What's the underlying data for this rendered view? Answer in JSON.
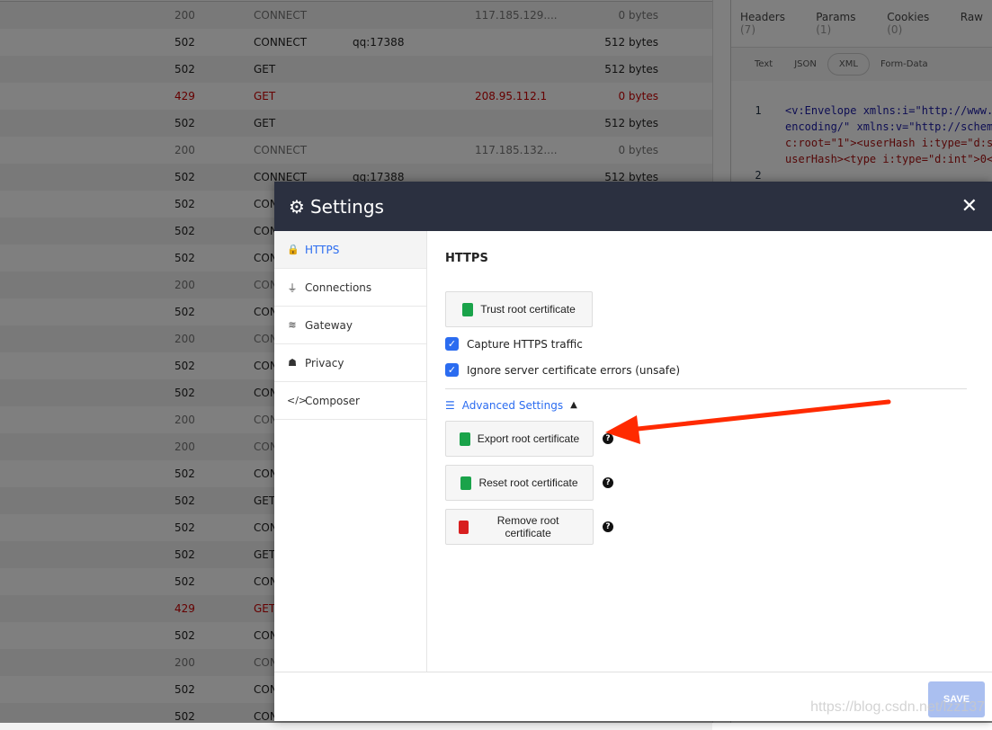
{
  "requests": [
    {
      "status": "200",
      "method": "CONNECT",
      "host": "",
      "ip": "117.185.129....",
      "size": "0 bytes",
      "tone": "gray"
    },
    {
      "status": "502",
      "method": "CONNECT",
      "host": "qq:17388",
      "ip": "",
      "size": "512 bytes",
      "tone": ""
    },
    {
      "status": "502",
      "method": "GET",
      "host": "",
      "ip": "",
      "size": "512 bytes",
      "tone": ""
    },
    {
      "status": "429",
      "method": "GET",
      "host": "",
      "ip": "208.95.112.1",
      "size": "0 bytes",
      "tone": "red"
    },
    {
      "status": "502",
      "method": "GET",
      "host": "",
      "ip": "",
      "size": "512 bytes",
      "tone": ""
    },
    {
      "status": "200",
      "method": "CONNECT",
      "host": "",
      "ip": "117.185.132....",
      "size": "0 bytes",
      "tone": "gray"
    },
    {
      "status": "502",
      "method": "CONNECT",
      "host": "qq:17388",
      "ip": "",
      "size": "512 bytes",
      "tone": ""
    },
    {
      "status": "502",
      "method": "CON",
      "tone": ""
    },
    {
      "status": "502",
      "method": "CON",
      "tone": ""
    },
    {
      "status": "502",
      "method": "CON",
      "tone": ""
    },
    {
      "status": "200",
      "method": "CON",
      "tone": "gray"
    },
    {
      "status": "502",
      "method": "CON",
      "tone": ""
    },
    {
      "status": "200",
      "method": "CON",
      "tone": "gray"
    },
    {
      "status": "502",
      "method": "CON",
      "tone": ""
    },
    {
      "status": "502",
      "method": "CON",
      "tone": ""
    },
    {
      "status": "200",
      "method": "CON",
      "tone": "gray"
    },
    {
      "status": "200",
      "method": "CON",
      "tone": "gray"
    },
    {
      "status": "502",
      "method": "CON",
      "tone": ""
    },
    {
      "status": "502",
      "method": "GET",
      "tone": ""
    },
    {
      "status": "502",
      "method": "CON",
      "tone": ""
    },
    {
      "status": "502",
      "method": "GET",
      "tone": ""
    },
    {
      "status": "502",
      "method": "CON",
      "tone": ""
    },
    {
      "status": "429",
      "method": "GET",
      "tone": "red"
    },
    {
      "status": "502",
      "method": "CON",
      "tone": ""
    },
    {
      "status": "200",
      "method": "CON",
      "tone": "gray"
    },
    {
      "status": "502",
      "method": "CON",
      "tone": ""
    },
    {
      "status": "502",
      "method": "CON",
      "tone": ""
    }
  ],
  "detail": {
    "tabs": [
      {
        "label": "Headers",
        "count": "(7)"
      },
      {
        "label": "Params",
        "count": "(1)"
      },
      {
        "label": "Cookies",
        "count": "(0)"
      },
      {
        "label": "Raw",
        "count": ""
      }
    ],
    "body_tabs": [
      "Text",
      "JSON",
      "XML",
      "Form-Data"
    ],
    "active_body_tab": "XML",
    "code_lines": [
      "<v:Envelope xmlns:i=\"http://www.",
      "encoding/\" xmlns:v=\"http://schem",
      "c:root=\"1\"><userHash i:type=\"d:s",
      "userHash><type i:type=\"d:int\">0<"
    ],
    "line_numbers": [
      "1",
      "2"
    ]
  },
  "settings": {
    "title": "Settings",
    "close": "✕",
    "nav": [
      {
        "label": "HTTPS",
        "icon": "lock-icon",
        "glyph": "🔒"
      },
      {
        "label": "Connections",
        "icon": "plug-icon",
        "glyph": "⏚"
      },
      {
        "label": "Gateway",
        "icon": "wifi-icon",
        "glyph": "≋"
      },
      {
        "label": "Privacy",
        "icon": "user-lock-icon",
        "glyph": "☗"
      },
      {
        "label": "Composer",
        "icon": "code-icon",
        "glyph": "</>"
      }
    ],
    "section_title": "HTTPS",
    "trust_button": "Trust root certificate",
    "checkboxes": [
      {
        "label": "Capture HTTPS traffic",
        "checked": true
      },
      {
        "label": "Ignore server certificate errors (unsafe)",
        "checked": true
      }
    ],
    "advanced_label": "Advanced Settings",
    "cert_actions": [
      {
        "label": "Export root certificate",
        "color": "#1aa34a"
      },
      {
        "label": "Reset root certificate",
        "color": "#1aa34a"
      },
      {
        "label": "Remove root certificate",
        "color": "#d81f1f"
      }
    ],
    "help": "?",
    "save": "SAVE"
  },
  "watermark": "https://blog.csdn.net/lzz137",
  "colors": {
    "accent": "#2b6cf0",
    "header": "#2b3040",
    "arrow": "#ff2a00",
    "save_disabled": "#aabff0"
  }
}
